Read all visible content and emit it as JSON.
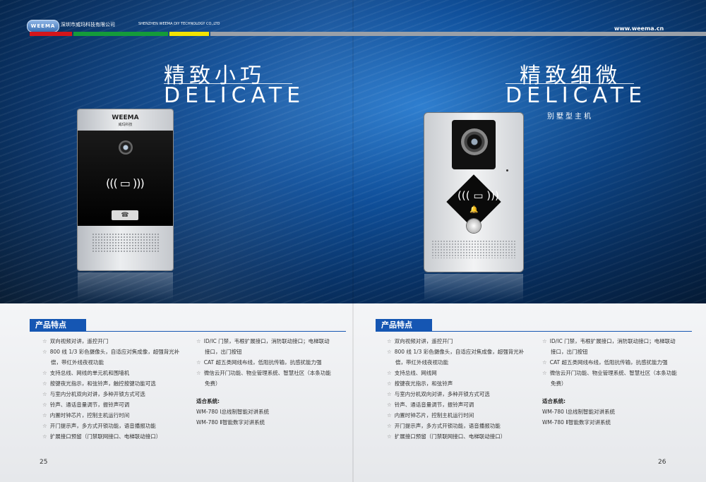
{
  "header": {
    "logo": "WEEMA",
    "company_cn": "深圳市威玛科技有限公司",
    "company_en": "SHENZHEN WEEMA DIY TECHNOLOGY CO.,LTD",
    "url": "www.weema.cn",
    "bar_colors": [
      "#d4151b",
      "#149b3a",
      "#f2e300",
      "#9aa0a8"
    ]
  },
  "left": {
    "title_cn": "精致小巧",
    "title_en": "DELICATE",
    "device_brand": "WEEMA",
    "device_brand_sub": "威玛科技",
    "features_title": "产品特点",
    "col1": [
      "双向视频对讲，遥控开门",
      "800 线 1/3 彩色摄像头，自适应对焦成像，超强背光补",
      "偿，带红外线夜视功能",
      "支持总线、网线的单元机和围墙机",
      "按键夜光指示，和弦铃声，触控按键功能可选",
      "与室内分机双向对讲，多种开锁方式可选",
      "铃声、通话音量调节，振铃声可调",
      "内置时钟芯片，控制主机运行时间",
      "开门提示声，多方式开锁功能，语音播报功能",
      "扩展接口预留（门禁联网接口、电梯联动接口）"
    ],
    "col2": [
      "ID/IC 门禁，韦根扩展接口，消防联动接口；电梯联动",
      "接口，出门按钮",
      "CAT 超五类网线布线，低阻抗传输，抗感扰能力强",
      "微信云开门功能、物业管理系统、智慧社区（本条功能",
      "免费）"
    ],
    "systems_title": "适合系统:",
    "systems": [
      "WM-780 Ⅰ总线制智能对讲系统",
      "WM-780 Ⅱ智能数字对讲系统"
    ],
    "page": "25"
  },
  "right": {
    "title_cn": "精致细微",
    "title_en": "DELICATE",
    "subtitle": "别墅型主机",
    "features_title": "产品特点",
    "col1": [
      "双向视频对讲，遥控开门",
      "800 线 1/3 彩色摄像头，自适应对焦成像，超强背光补",
      "偿，带红外线夜视功能",
      "支持总线、网线网",
      "按键夜光指示，和弦铃声",
      "与室内分机双向对讲，多种开锁方式可选",
      "铃声、通话音量调节，振铃声可调",
      "内置时钟芯片，控制主机运行时间",
      "开门提示声，多方式开锁功能，语音播报功能",
      "扩展接口预留（门禁联网接口、电梯联动接口）"
    ],
    "col2": [
      "ID/IC 门禁，韦根扩展接口，消防联动接口；电梯联动",
      "接口，出门按钮",
      "CAT 超五类网线布线，低阻抗传输，抗感扰能力强",
      "微信云开门功能、物业管理系统、智慧社区（本条功能",
      "免费）"
    ],
    "systems_title": "适合系统:",
    "systems": [
      "WM-780 Ⅰ总线制智能对讲系统",
      "WM-780 Ⅱ智能数字对讲系统"
    ],
    "page": "26"
  }
}
